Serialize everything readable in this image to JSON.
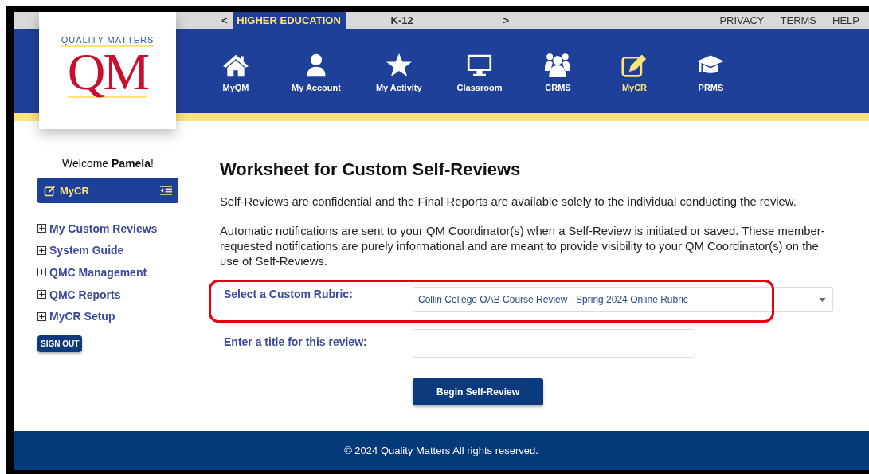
{
  "logo": {
    "tagline": "QUALITY MATTERS",
    "letters": "QM"
  },
  "top_tabs": [
    {
      "label": "<",
      "kind": "arrow"
    },
    {
      "label": "HIGHER EDUCATION",
      "kind": "tab",
      "selected": true
    },
    {
      "label": "K-12",
      "kind": "tab",
      "selected": false
    },
    {
      "label": ">",
      "kind": "arrow"
    }
  ],
  "top_links": [
    "PRIVACY",
    "TERMS",
    "HELP"
  ],
  "nav": [
    {
      "label": "MyQM",
      "kind": "house",
      "selected": false
    },
    {
      "label": "My Account",
      "kind": "person",
      "selected": false
    },
    {
      "label": "My Activity",
      "kind": "star",
      "selected": false
    },
    {
      "label": "Classroom",
      "kind": "monitor",
      "selected": false
    },
    {
      "label": "CRMS",
      "kind": "group",
      "selected": false
    },
    {
      "label": "MyCR",
      "kind": "edit",
      "selected": true
    },
    {
      "label": "PRMS",
      "kind": "cap",
      "selected": false
    }
  ],
  "sidebar": {
    "welcome": "Welcome **Pamela**!",
    "section": "MyCR",
    "items": [
      {
        "label": "My Custom Reviews",
        "expanded": false
      },
      {
        "label": "System Guide",
        "expanded": false
      },
      {
        "label": "QMC Management",
        "expanded": false
      },
      {
        "label": "QMC Reports",
        "expanded": false
      },
      {
        "label": "MyCR Setup",
        "expanded": false
      }
    ],
    "sign_out": "SIGN OUT"
  },
  "main": {
    "title": "Worksheet for Custom Self-Reviews",
    "paragraphs": [
      "Self-Reviews are confidential and the Final Reports are available solely to the individual conducting the review.",
      "Automatic notifications are sent to your QM Coordinator(s) when a Self-Review is initiated or saved. These member-requested notifications are purely informational and are meant to provide visibility to your QM Coordinator(s) on the use of Self-Reviews."
    ],
    "rubric": {
      "label": "Select a Custom Rubric:",
      "value": "Collin College OAB Course Review - Spring 2024 Online Rubric",
      "highlighted": true
    },
    "review_title": {
      "label": "Enter a title for this review:"
    },
    "submit": "Begin Self-Review"
  },
  "footer": "© 2024 Quality Matters All rights reserved."
}
